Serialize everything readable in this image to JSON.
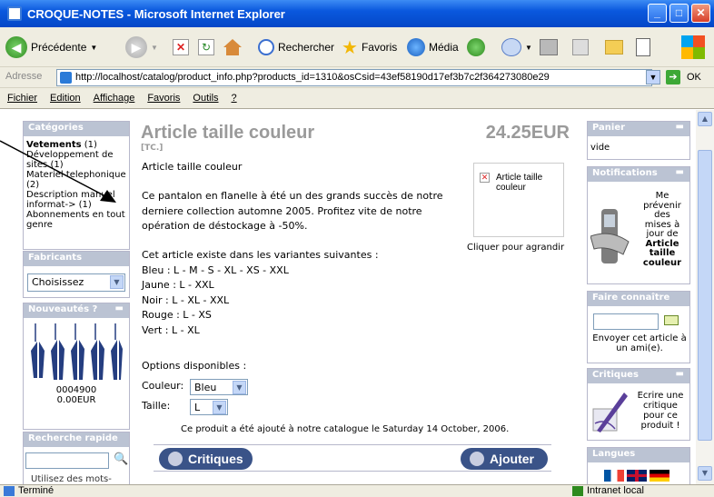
{
  "window": {
    "title": "CROQUE-NOTES - Microsoft Internet Explorer"
  },
  "toolbar": {
    "back": "Précédente",
    "search": "Rechercher",
    "favorites": "Favoris",
    "media": "Média"
  },
  "address": {
    "label": "Adresse",
    "url": "http://localhost/catalog/product_info.php?products_id=1310&osCsid=43ef58190d17ef3b7c2f364273080e29",
    "go": "OK"
  },
  "menu": [
    "Fichier",
    "Edition",
    "Affichage",
    "Favoris",
    "Outils",
    "?"
  ],
  "left": {
    "categories": {
      "title": "Catégories",
      "items": [
        {
          "name": "Vetements",
          "count": "(1)"
        },
        {
          "name": "Développement de sites",
          "count": "(1)"
        },
        {
          "name": "Materiel telephonique",
          "count": "(2)"
        },
        {
          "name": "Description manuel informat->",
          "count": "(1)"
        },
        {
          "name": "Abonnements en tout genre",
          "count": ""
        }
      ]
    },
    "manufacturers": {
      "title": "Fabricants",
      "selected": "Choisissez"
    },
    "new": {
      "title": "Nouveautés ?",
      "code": "0004900",
      "price": "0.00EUR"
    },
    "quicksearch": {
      "title": "Recherche rapide",
      "hint": "Utilisez des mots-"
    }
  },
  "product": {
    "title": "Article taille couleur",
    "price": "24.25EUR",
    "model": "[TC.]",
    "name_line": "Article taille couleur",
    "description": [
      "Ce pantalon en flanelle à été un des grands succès de notre",
      "derniere collection automne 2005. Profitez vite de notre",
      "opération de déstockage à -50%."
    ],
    "variants_intro": "Cet article existe dans les variantes suivantes :",
    "variants": [
      "Bleu : L - M - S - XL - XS - XXL",
      "Jaune : L - XXL",
      "Noir : L - XL - XXL",
      "Rouge : L - XS",
      "Vert : L - XL"
    ],
    "options_title": "Options disponibles :",
    "color_label": "Couleur:",
    "color_value": "Bleu",
    "size_label": "Taille:",
    "size_value": "L",
    "image_alt": "Article taille couleur",
    "enlarge": "Cliquer pour agrandir",
    "added": "Ce produit a été ajouté à notre catalogue le Saturday 14 October, 2006.",
    "reviews_btn": "Critiques",
    "add_btn": "Ajouter"
  },
  "right": {
    "cart": {
      "title": "Panier",
      "body": "vide"
    },
    "notifications": {
      "title": "Notifications",
      "lines": [
        "Me",
        "prévenir",
        "des",
        "mises à",
        "jour de"
      ],
      "bold": [
        "Article",
        "taille",
        "couleur"
      ]
    },
    "tell": {
      "title": "Faire connaître",
      "text": "Envoyer cet article à un ami(e)."
    },
    "reviews": {
      "title": "Critiques",
      "lines": [
        "Ecrire une",
        "critique",
        "pour ce",
        "produit !"
      ]
    },
    "languages": {
      "title": "Langues"
    }
  },
  "status": {
    "left": "Terminé",
    "zone": "Intranet local"
  }
}
